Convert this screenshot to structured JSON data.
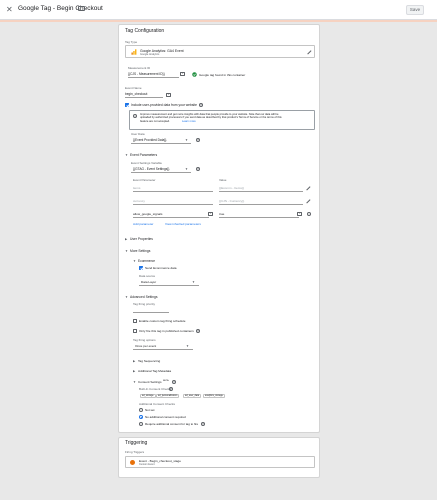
{
  "header": {
    "close_icon": "close-icon",
    "title": "Google Tag - Begin Checkout",
    "folder_icon": "folder-icon",
    "save_label": "Save"
  },
  "tag_config": {
    "heading": "Tag Configuration",
    "tag_type_label": "Tag Type",
    "tag_type_name": "Google Analytics: GA4 Event",
    "tag_type_sub": "Google Analytics",
    "measurement_id_label": "Measurement ID",
    "measurement_id_value": "{{CJS - Measurement ID}}",
    "measurement_status": "Google tag found in this container",
    "event_name_label": "Event Name",
    "event_name_value": "begin_checkout",
    "include_ua_label": "Include user-provided data from your website",
    "include_ua_checked": true,
    "ua_info_text": [
      "Improve measurement and get more insights with data that people provide to your website. Note that our data will be",
      "uploaded by authorized processors if you send data as described by that product's Terms of Service or the terms of this",
      "feature are not accepted."
    ],
    "ua_learn_more": "Learn more",
    "user_data_label": "User Data",
    "user_data_value": "{{Event Provided Data}}",
    "event_params_title": "Event Parameters",
    "event_settings_label": "Event Settings Variable",
    "event_settings_value": "{{GTAG - Event Settings}}",
    "param_header_name": "Event Parameter",
    "param_header_value": "Value",
    "params": [
      {
        "name": "items",
        "value": "{{Ecomm - Items}}"
      },
      {
        "name": "currency",
        "value": "{{CJS - Currency}}"
      },
      {
        "name": "allow_google_signals",
        "value": "true"
      }
    ],
    "add_parameter": "Add parameter",
    "view_inherited": "View inherited parameters",
    "user_properties": "User Properties",
    "more_settings": "More Settings",
    "ecommerce_label": "Ecommerce",
    "send_ecommerce_label": "Send Ecommerce data",
    "send_ecommerce_checked": true,
    "data_source_label": "Data source",
    "data_source_value": "Data Layer",
    "advanced_settings": "Advanced Settings",
    "tag_firing_priority": "Tag firing priority",
    "enable_custom_schedule": "Enable custom tag firing schedule",
    "only_fire_published": "Only fire this tag in published containers",
    "tag_firing_options_label": "Tag firing options",
    "tag_firing_options_value": "Once per event",
    "tag_sequencing": "Tag Sequencing",
    "additional_metadata": "Additional Tag Metadata",
    "consent_settings": "Consent Settings",
    "consent_beta": "BETA",
    "built_in_consent_label": "Built-In Consent Checks",
    "built_in_consent": [
      "ad_storage",
      "ad_personalization",
      "ad_user_data",
      "analytics_storage"
    ],
    "additional_consent_label": "Additional Consent Checks",
    "consent_options": [
      {
        "label": "Not set",
        "selected": false
      },
      {
        "label": "No additional consent required",
        "selected": true
      },
      {
        "label": "Require additional consent for tag to fire",
        "selected": false
      }
    ]
  },
  "triggering": {
    "heading": "Triggering",
    "firing_label": "Firing Triggers",
    "trigger_name": "Event - Begin_checkout_stage",
    "trigger_type": "Custom Event"
  },
  "colors": {
    "accent": "#1a73e8",
    "trigger_icon": "#e8710a",
    "ga_icon": "#f9ab00"
  }
}
